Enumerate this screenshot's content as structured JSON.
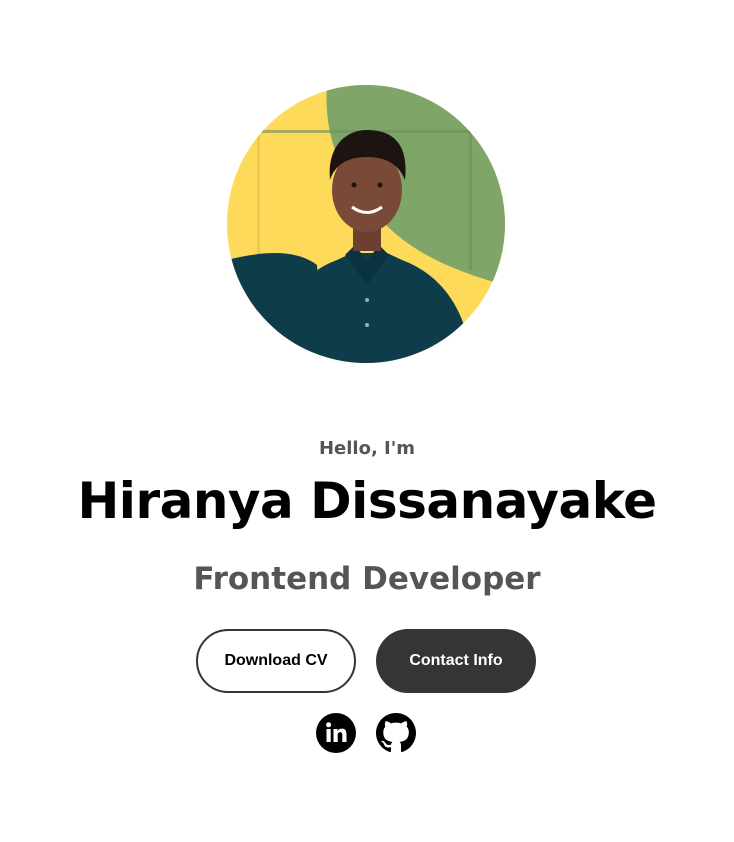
{
  "profile": {
    "greeting": "Hello, I'm",
    "name": "Hiranya Dissanayake",
    "role": "Frontend Developer"
  },
  "buttons": {
    "download_cv": "Download CV",
    "contact_info": "Contact Info"
  },
  "social": [
    {
      "name": "linkedin",
      "icon": "linkedin-icon"
    },
    {
      "name": "github",
      "icon": "github-icon"
    }
  ],
  "colors": {
    "accent_yellow": "#FDDA59",
    "accent_green": "#7FA569",
    "dark_navy": "#0F3C4B",
    "button_dark": "#353535",
    "text_muted": "#555555"
  }
}
